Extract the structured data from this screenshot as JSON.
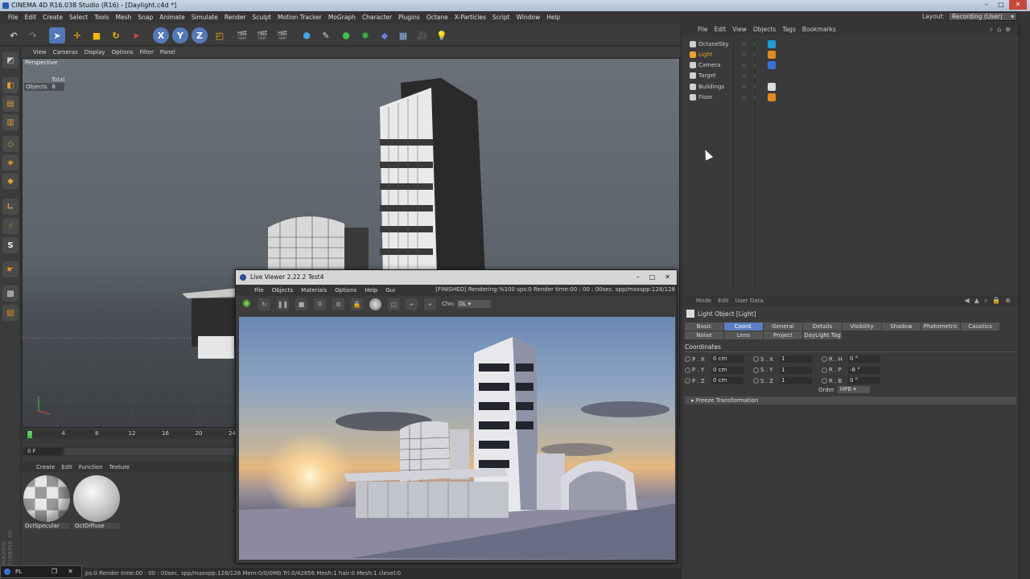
{
  "window": {
    "title": "CINEMA 4D R16.038 Studio (R16) - [Daylight.c4d *]",
    "min": "–",
    "max": "□",
    "close": "✕"
  },
  "menubar": [
    "File",
    "Edit",
    "Create",
    "Select",
    "Tools",
    "Mesh",
    "Snap",
    "Animate",
    "Simulate",
    "Render",
    "Sculpt",
    "Motion Tracker",
    "MoGraph",
    "Character",
    "Plugins",
    "Octane",
    "X-Particles",
    "Script",
    "Window",
    "Help"
  ],
  "layout": {
    "label": "Layout:",
    "value": "Recording (User)"
  },
  "toolbar": {
    "axes": [
      "X",
      "Y",
      "Z"
    ]
  },
  "viewport": {
    "menu": [
      "View",
      "Cameras",
      "Display",
      "Options",
      "Filter",
      "Panel"
    ],
    "label": "Perspective",
    "hud_header": "Total",
    "hud_label": "Objects",
    "hud_value": "8"
  },
  "timeline": {
    "ticks": [
      "0",
      "4",
      "8",
      "12",
      "16",
      "20",
      "24"
    ],
    "frame": "0 F"
  },
  "material_manager": {
    "menu": [
      "Create",
      "Edit",
      "Function",
      "Texture"
    ],
    "materials": [
      {
        "name": "OctSpecular"
      },
      {
        "name": "OctDiffuse"
      }
    ]
  },
  "statusbar": {
    "text": "ps:0 Render time:00 : 00 : 00sec. spp/maxspp:128/128 Mem:0/0/0Mb Tri:0/42856 Mesh:1 hair:0 Mesh:1 clevel:0",
    "task": "PL"
  },
  "maxon": "MAXON CINEMA 4D",
  "object_manager": {
    "menu": [
      "File",
      "Edit",
      "View",
      "Objects",
      "Tags",
      "Bookmarks"
    ],
    "objects": [
      {
        "name": "OctaneSky",
        "color": "#cfcfcf",
        "tag_color": "#1e9bd8"
      },
      {
        "name": "Light",
        "color": "#f0a030",
        "tag_color": "#e08a20"
      },
      {
        "name": "Camera",
        "color": "#cfcfcf",
        "tag_color": "#3a6fd8"
      },
      {
        "name": "Target",
        "color": "#cfcfcf",
        "tag_color": ""
      },
      {
        "name": "Buildings",
        "color": "#cfcfcf",
        "tag_color": "#dddddd"
      },
      {
        "name": "Floor",
        "color": "#cfcfcf",
        "tag_color": "#e08a20"
      }
    ]
  },
  "attributes": {
    "menu": [
      "Mode",
      "Edit",
      "User Data"
    ],
    "title": "Light Object [Light]",
    "tabs_row1": [
      "Basic",
      "Coord.",
      "General",
      "Details",
      "Visibility",
      "Shadow",
      "Photometric",
      "Caustics"
    ],
    "tabs_row2": [
      "Noise",
      "Lens",
      "Project",
      "DayLight Tag"
    ],
    "active_tab": "Coord.",
    "section": "Coordinates",
    "rows": [
      [
        {
          "label": "P . X",
          "value": "0 cm"
        },
        {
          "label": "S . X",
          "value": "1"
        },
        {
          "label": "R . H",
          "value": "0 °"
        }
      ],
      [
        {
          "label": "P . Y",
          "value": "0 cm"
        },
        {
          "label": "S . Y",
          "value": "1"
        },
        {
          "label": "R . P",
          "value": "-8 °"
        }
      ],
      [
        {
          "label": "P . Z",
          "value": "0 cm"
        },
        {
          "label": "S . Z",
          "value": "1"
        },
        {
          "label": "R . B",
          "value": "0 °"
        }
      ]
    ],
    "order_label": "Order",
    "order_value": "HPB",
    "freeze": "Freeze Transformation"
  },
  "live_viewer": {
    "title": "Live Viewer 2.22.2 Test4",
    "menu": [
      "File",
      "Objects",
      "Materials",
      "Options",
      "Help",
      "Gui"
    ],
    "status": "[FINISHED]   Rendering:%100 sps:0 Render time:00 : 00 : 00sec. spp/maxspp:128/128",
    "channel_label": "Chn:",
    "channel_value": "DL"
  },
  "colors": {
    "accent": "#5a7fbf",
    "bg": "#3a3a3a"
  }
}
